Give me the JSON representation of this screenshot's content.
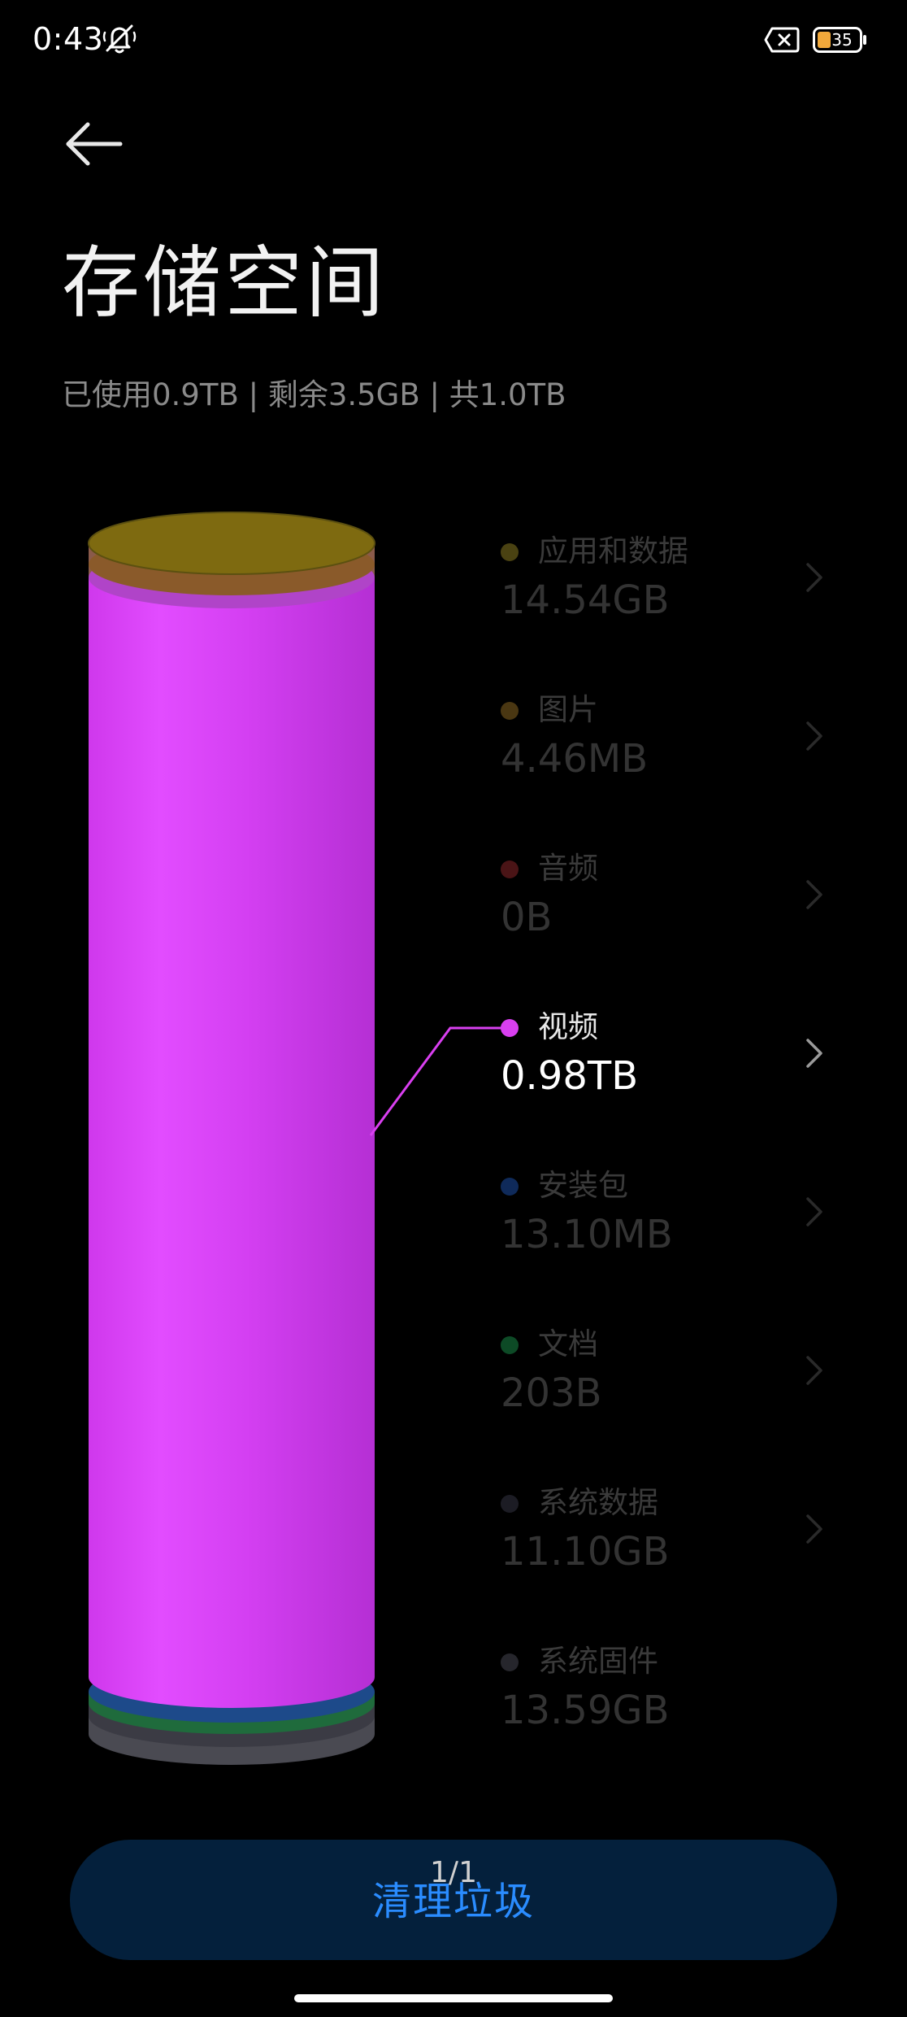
{
  "status_bar": {
    "time": "0:43",
    "battery_level": "35",
    "mute_icon": "bell-off-icon",
    "close_icon": "close-box-icon",
    "battery_icon": "battery-icon"
  },
  "header": {
    "back_icon": "arrow-left-icon",
    "title": "存储空间",
    "summary": "已使用0.9TB | 剩余3.5GB | 共1.0TB"
  },
  "categories": [
    {
      "name": "应用和数据",
      "size": "14.54GB",
      "color": "#7a6a10",
      "active": false
    },
    {
      "name": "图片",
      "size": "4.46MB",
      "color": "#6a5210",
      "active": false
    },
    {
      "name": "音频",
      "size": "0B",
      "color": "#5a1416",
      "active": false
    },
    {
      "name": "视频",
      "size": "0.98TB",
      "color": "#d93ff0",
      "active": true
    },
    {
      "name": "安装包",
      "size": "13.10MB",
      "color": "#0f2a5a",
      "active": false
    },
    {
      "name": "文档",
      "size": "203B",
      "color": "#0d4a26",
      "active": false
    },
    {
      "name": "系统数据",
      "size": "11.10GB",
      "color": "#1c1c24",
      "active": false
    },
    {
      "name": "系统固件",
      "size": "13.59GB",
      "color": "#26262c",
      "active": false
    }
  ],
  "chevron_icon": "chevron-right-icon",
  "footer": {
    "page_indicator": "1/1",
    "cleanup_label": "清理垃圾"
  },
  "colors": {
    "accent": "#2a8cff",
    "video": "#d93ff0",
    "button_bg": "#04203c"
  }
}
